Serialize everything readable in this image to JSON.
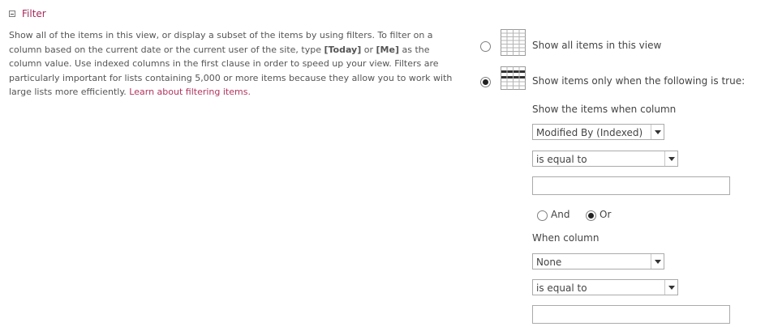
{
  "section": {
    "title": "Filter"
  },
  "description": {
    "text_1": "Show all of the items in this view, or display a subset of the items by using filters. To filter on a column based on the current date or the current user of the site, type ",
    "today": "[Today]",
    "text_2": " or ",
    "me": "[Me]",
    "text_3": " as the column value. Use indexed columns in the first clause in order to speed up your view. Filters are particularly important for lists containing 5,000 or more items because they allow you to work with large lists more efficiently. ",
    "link": "Learn about filtering items."
  },
  "options": {
    "show_all_label": "Show all items in this view",
    "show_filtered_label": "Show items only when the following is true:",
    "selected": "show_filtered"
  },
  "clause1": {
    "label": "Show the items when column",
    "column": "Modified By (Indexed)",
    "operator": "is equal to",
    "value": ""
  },
  "connector": {
    "and_label": "And",
    "or_label": "Or",
    "selected": "Or"
  },
  "clause2": {
    "label": "When column",
    "column": "None",
    "operator": "is equal to",
    "value": ""
  },
  "colors": {
    "accent": "#a5285a",
    "text": "#444444"
  }
}
